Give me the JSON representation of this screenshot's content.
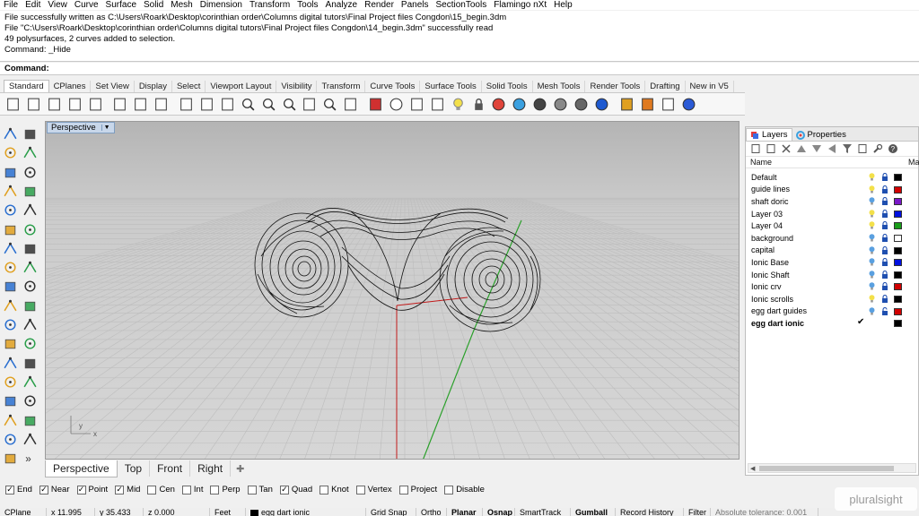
{
  "menu": [
    "File",
    "Edit",
    "View",
    "Curve",
    "Surface",
    "Solid",
    "Mesh",
    "Dimension",
    "Transform",
    "Tools",
    "Analyze",
    "Render",
    "Panels",
    "SectionTools",
    "Flamingo nXt",
    "Help"
  ],
  "command_history": [
    "File successfully written as C:\\Users\\Roark\\Desktop\\corinthian order\\Columns digital tutors\\Final Project files Congdon\\15_begin.3dm",
    "File \"C:\\Users\\Roark\\Desktop\\corinthian order\\Columns digital tutors\\Final Project files Congdon\\14_begin.3dm\" successfully read",
    "49 polysurfaces, 2 curves added to selection.",
    "Command: _Hide"
  ],
  "command_prompt": "Command:",
  "toolbar_tabs": [
    "Standard",
    "CPlanes",
    "Set View",
    "Display",
    "Select",
    "Viewport Layout",
    "Visibility",
    "Transform",
    "Curve Tools",
    "Surface Tools",
    "Solid Tools",
    "Mesh Tools",
    "Render Tools",
    "Drafting",
    "New in V5"
  ],
  "active_toolbar_tab": "Standard",
  "viewport": {
    "title": "Perspective",
    "dropdown": "▼",
    "axis_y": "y",
    "axis_x": "x"
  },
  "viewport_tabs": [
    "Perspective",
    "Top",
    "Front",
    "Right"
  ],
  "active_viewport_tab": "Perspective",
  "add_viewport": "✚",
  "osnaps": [
    {
      "label": "End",
      "checked": true
    },
    {
      "label": "Near",
      "checked": true
    },
    {
      "label": "Point",
      "checked": true
    },
    {
      "label": "Mid",
      "checked": true
    },
    {
      "label": "Cen",
      "checked": false
    },
    {
      "label": "Int",
      "checked": false
    },
    {
      "label": "Perp",
      "checked": false
    },
    {
      "label": "Tan",
      "checked": false
    },
    {
      "label": "Quad",
      "checked": true
    },
    {
      "label": "Knot",
      "checked": false
    },
    {
      "label": "Vertex",
      "checked": false
    },
    {
      "label": "Project",
      "checked": false
    },
    {
      "label": "Disable",
      "checked": false
    }
  ],
  "status": {
    "cplane": "CPlane",
    "x": "x 11.995",
    "y": "y 35.433",
    "z": "z 0.000",
    "units": "Feet",
    "layer": "egg dart ionic",
    "grid_snap": "Grid Snap",
    "ortho": "Ortho",
    "planar": "Planar",
    "osnap": "Osnap",
    "smarttrack": "SmartTrack",
    "gumball": "Gumball",
    "record_history": "Record History",
    "filter": "Filter",
    "tolerance": "Absolute tolerance: 0.001"
  },
  "panel": {
    "tabs": [
      "Layers",
      "Properties"
    ],
    "active_tab": "Layers",
    "header_name": "Name",
    "header_material": "Ma",
    "layers": [
      {
        "name": "Default",
        "bulb": "#f3e04a",
        "color": "#000000",
        "current": false
      },
      {
        "name": "guide lines",
        "bulb": "#f3e04a",
        "color": "#d10000",
        "current": false
      },
      {
        "name": "shaft doric",
        "bulb": "#5aa0e0",
        "color": "#7a18c8",
        "current": false
      },
      {
        "name": "Layer 03",
        "bulb": "#f3e04a",
        "color": "#0010e0",
        "current": false
      },
      {
        "name": "Layer 04",
        "bulb": "#f3e04a",
        "color": "#1a9e1a",
        "current": false
      },
      {
        "name": "background",
        "bulb": "#5aa0e0",
        "color": "#ffffff",
        "current": false
      },
      {
        "name": "capital",
        "bulb": "#5aa0e0",
        "color": "#000000",
        "current": false
      },
      {
        "name": "Ionic Base",
        "bulb": "#5aa0e0",
        "color": "#0010e0",
        "current": false
      },
      {
        "name": "Ionic Shaft",
        "bulb": "#5aa0e0",
        "color": "#000000",
        "current": false
      },
      {
        "name": "Ionic crv",
        "bulb": "#5aa0e0",
        "color": "#d10000",
        "current": false
      },
      {
        "name": "Ionic scrolls",
        "bulb": "#f3e04a",
        "color": "#000000",
        "current": false
      },
      {
        "name": "egg dart guides",
        "bulb": "#5aa0e0",
        "color": "#d10000",
        "current": false
      },
      {
        "name": "egg dart ionic",
        "bulb": "",
        "color": "#000000",
        "current": true
      }
    ],
    "current_mark": "✔"
  },
  "watermark": "pluralsight"
}
